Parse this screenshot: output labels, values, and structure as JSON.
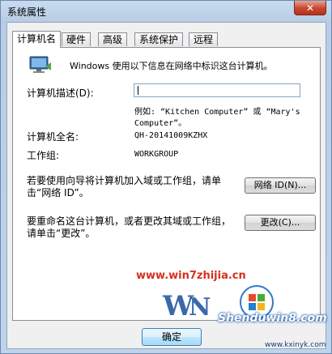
{
  "window": {
    "title": "系统属性",
    "close_glyph": "✕"
  },
  "tabs": [
    {
      "label": "计算机名",
      "active": true
    },
    {
      "label": "硬件",
      "active": false
    },
    {
      "label": "高级",
      "active": false
    },
    {
      "label": "系统保护",
      "active": false
    },
    {
      "label": "远程",
      "active": false
    }
  ],
  "panel": {
    "intro": "Windows 使用以下信息在网络中标识这台计算机。",
    "description_label": "计算机描述(D):",
    "description_value": "",
    "example_line1": "例如: “Kitchen Computer” 或 “Mary's",
    "example_line2": "Computer”。",
    "fullname_label": "计算机全名:",
    "fullname_value": "QH-20141009KZHX",
    "workgroup_label": "工作组:",
    "workgroup_value": "WORKGROUP",
    "network_text_line1": "若要使用向导将计算机加入域或工作组，请单",
    "network_text_line2": "击“网络 ID”。",
    "network_button": "网络 ID(N)...",
    "rename_text_line1": "要重命名这台计算机，或者更改其域或工作组，",
    "rename_text_line2": "请单击“更改”。",
    "change_button": "更改(C)..."
  },
  "footer": {
    "ok_button": "确定"
  },
  "watermarks": {
    "site1": "www.win7zhijia.cn",
    "site2": "Shenduwin8.com",
    "site3": "www.kxinyk.com"
  },
  "colors": {
    "title_bar": "#b8cde5",
    "close_button": "#c7452e",
    "watermark_red": "#d6301f"
  },
  "icons": {
    "computer": "monitor-network-icon"
  }
}
